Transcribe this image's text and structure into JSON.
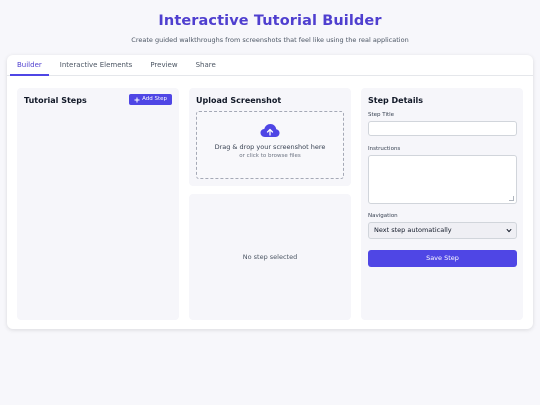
{
  "header": {
    "title": "Interactive Tutorial Builder",
    "subtitle": "Create guided walkthroughs from screenshots that feel like using the real application"
  },
  "tabs": [
    {
      "label": "Builder",
      "active": true
    },
    {
      "label": "Interactive Elements",
      "active": false
    },
    {
      "label": "Preview",
      "active": false
    },
    {
      "label": "Share",
      "active": false
    }
  ],
  "steps_panel": {
    "title": "Tutorial Steps",
    "add_button": "Add Step",
    "add_icon": "plus-icon"
  },
  "upload_panel": {
    "title": "Upload Screenshot",
    "icon": "cloud-upload-icon",
    "drop_text": "Drag & drop your screenshot here",
    "drop_subtext": "or click to browse files"
  },
  "preview_panel": {
    "empty_text": "No step selected"
  },
  "details_panel": {
    "title": "Step Details",
    "step_title_label": "Step Title",
    "step_title_value": "",
    "instructions_label": "Instructions",
    "instructions_value": "",
    "navigation_label": "Navigation",
    "navigation_selected": "Next step automatically",
    "save_button": "Save Step"
  },
  "colors": {
    "accent": "#4f46e5",
    "title": "#4f3fcf",
    "panel_bg": "#f6f6fa",
    "page_bg": "#f7f7fb"
  }
}
